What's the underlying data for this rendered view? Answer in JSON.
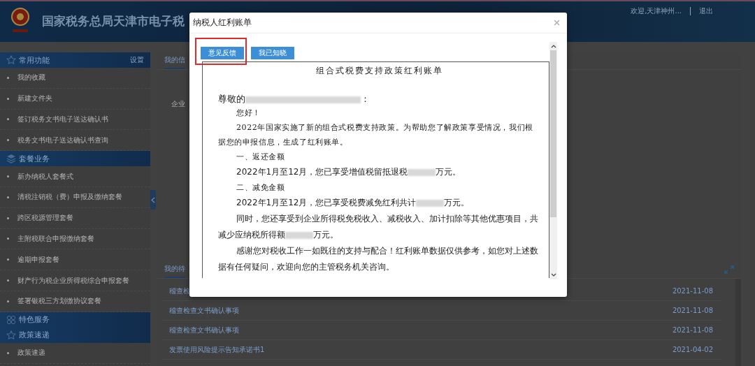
{
  "header": {
    "title": "国家税务总局天津市电子税",
    "user": "欢迎,天津神州...",
    "logout": "退出"
  },
  "sidebar": {
    "sections": [
      {
        "title": "常用功能",
        "action": "设置",
        "items": [
          "我的收藏",
          "新建文件夹",
          "签订税务文书电子送达确认书",
          "税务文书电子送达确认书查询"
        ]
      },
      {
        "title": "套餐业务",
        "items": [
          "新办纳税人套餐式",
          "清税注销税（费）申报及缴纳套餐",
          "跨区税源管理套餐",
          "主附税联合申报缴纳套餐",
          "逾期申报套餐",
          "财产行为税企业所得税综合申报套餐",
          "签署银税三方划缴协议套餐"
        ]
      },
      {
        "title": "特色服务"
      },
      {
        "title": "政策速递",
        "items": [
          "政策速递"
        ]
      }
    ]
  },
  "info_panel": {
    "tab": "我的信",
    "field_label": "企业"
  },
  "todo_panel": {
    "tab": "我的待",
    "rows": [
      {
        "title": "稽查检",
        "date": "2021-11-08"
      },
      {
        "title": "稽查检查文书确认事项",
        "date": "2021-11-08"
      },
      {
        "title": "稽查检查文书确认事项",
        "date": "2021-11-08"
      },
      {
        "title": "发票使用风险提示告知承诺书1",
        "date": "2021-04-02"
      }
    ]
  },
  "modal": {
    "title": "纳税人红利账单",
    "buttons": [
      {
        "label": "意见反馈",
        "highlighted": true
      },
      {
        "label": "我已知晓",
        "highlighted": false
      }
    ],
    "document": [
      {
        "kind": "heading",
        "parts": [
          {
            "kind": "text",
            "text": "组合式税费支持政策红利账单"
          }
        ]
      },
      {
        "kind": "salutation",
        "parts": [
          {
            "kind": "text",
            "text": "尊敬的"
          },
          {
            "kind": "redacted"
          },
          {
            "kind": "text",
            "text": "："
          }
        ]
      },
      {
        "kind": "intro",
        "parts": [
          {
            "kind": "text",
            "text": "您好！"
          }
        ]
      },
      {
        "kind": "intro",
        "parts": [
          {
            "kind": "text",
            "text": "2022年国家实施了新的组合式税费支持政策。为帮助您了解政策享受情况，我们根据您的申报信息，生成了红利账单。"
          }
        ]
      },
      {
        "kind": "intro",
        "parts": [
          {
            "kind": "text",
            "text": "一、返还金额"
          }
        ]
      },
      {
        "kind": "body",
        "parts": [
          {
            "kind": "text",
            "text": "2022年1月至12月，您已享受增值税留抵退税"
          },
          {
            "kind": "redacted"
          },
          {
            "kind": "text",
            "text": "万元。"
          }
        ]
      },
      {
        "kind": "intro",
        "parts": [
          {
            "kind": "text",
            "text": "二、减免金额"
          }
        ]
      },
      {
        "kind": "body",
        "parts": [
          {
            "kind": "text",
            "text": "2022年1月至12月，您已享受税费减免红利共计"
          },
          {
            "kind": "redacted"
          },
          {
            "kind": "text",
            "text": "万元。"
          }
        ]
      },
      {
        "kind": "body",
        "parts": [
          {
            "kind": "text",
            "text": "同时，您还享受到企业所得税免税收入、减税收入、加计扣除等其他优惠项目，共减少应纳税所得额"
          },
          {
            "kind": "redacted"
          },
          {
            "kind": "text",
            "text": "万元。"
          }
        ]
      },
      {
        "kind": "body",
        "parts": [
          {
            "kind": "text",
            "text": "感谢您对税收工作一如既往的支持与配合！红利账单数据仅供参考，如您对上述数据有任何疑问，欢迎向您的主管税务机关咨询。"
          }
        ]
      }
    ]
  }
}
